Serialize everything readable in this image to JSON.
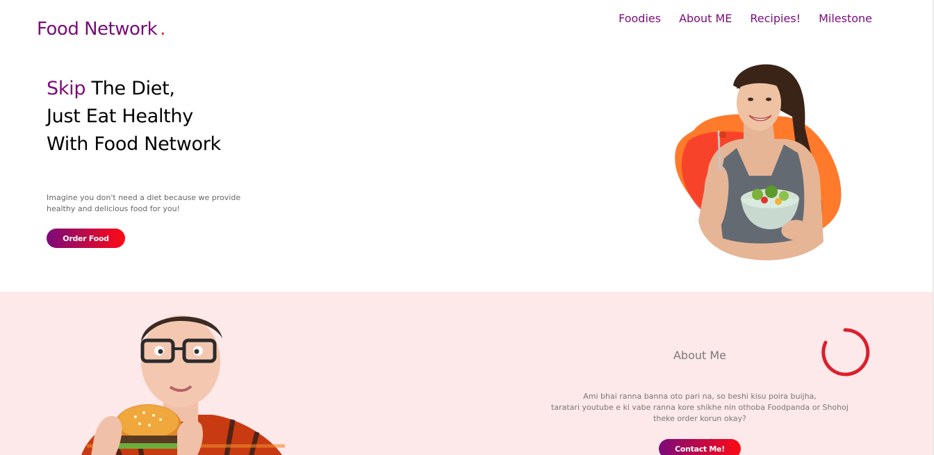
{
  "brand": {
    "name": "Food Network",
    "dot": ".",
    "color": "#7b0a7a",
    "dot_color": "#ee1a2a"
  },
  "nav": {
    "items": [
      "Foodies",
      "About ME",
      "Recipies!",
      "Milestone"
    ]
  },
  "hero": {
    "headline_accent": "Skip",
    "headline_line1_rest": " The Diet,",
    "headline_line2": "Just Eat Healthy",
    "headline_line3": "With Food Network",
    "description": "Imagine you don't need a diet because we provide healthy and delicious food for you!",
    "button_label": "Order Food",
    "image_icon": "woman-eating-salad-image"
  },
  "about": {
    "title": "About Me",
    "text_line1": "Ami bhai ranna banna oto pari na, so beshi kisu poira buijha,",
    "text_line2": "taratari youtube e ki vabe ranna kore shikhe nin othoba Foodpanda or Shohoj",
    "text_line3": "theke order korun okay?",
    "button_label": "Contact Me!",
    "image_icon": "man-eating-burger-image",
    "background_color": "#fde8ea"
  },
  "colors": {
    "gradient_start": "#7b0a7a",
    "gradient_end": "#ff0a14",
    "blob_orange": "#ff7a2a",
    "blob_red": "#f7392b",
    "spinner": "#d9202e"
  }
}
